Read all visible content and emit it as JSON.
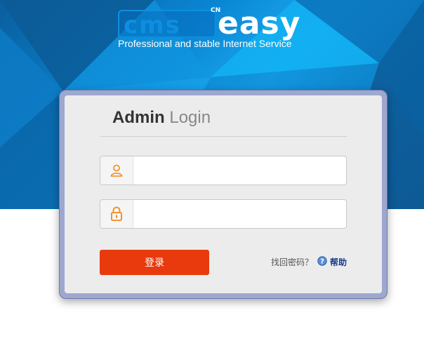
{
  "header": {
    "logo_cms": "cms",
    "logo_cn": "CN",
    "logo_easy": "easy",
    "tagline": "Professional and stable Internet Service"
  },
  "login": {
    "title_bold": "Admin",
    "title_light": "Login",
    "username": {
      "value": "",
      "placeholder": "",
      "icon": "user-icon"
    },
    "password": {
      "value": "",
      "placeholder": "",
      "icon": "lock-icon"
    },
    "submit_label": "登录",
    "forgot_label": "找回密码？",
    "help_label": "帮助",
    "help_icon": "help-circle-icon"
  },
  "colors": {
    "accent": "#e83a0d",
    "banner_blue": "#0a86d3",
    "icon_orange": "#f08a1c",
    "help_link": "#1a3a8a"
  }
}
